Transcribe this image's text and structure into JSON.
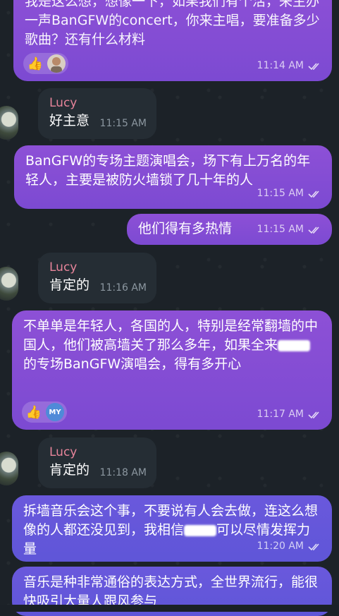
{
  "messages": [
    {
      "id": "m1",
      "direction": "out",
      "text_partial_top": "我是这么想，想像一下，如果我们有个活，",
      "text": "来主办一声BanGFW的concert，你来主唱，要准备多少歌曲？还有什么材料",
      "time": "11:14 AM",
      "reactions": [
        "thumbs-up",
        "user-avatar"
      ]
    },
    {
      "id": "m2",
      "direction": "in",
      "sender": "Lucy",
      "text": "好主意",
      "time": "11:15 AM"
    },
    {
      "id": "m3",
      "direction": "out",
      "text": "BanGFW的专场主题演唱会，场下有上万名的年轻人，主要是被防火墙锁了几十年的人",
      "time": "11:15 AM"
    },
    {
      "id": "m4",
      "direction": "out",
      "text": "他们得有多热情",
      "time": "11:15 AM"
    },
    {
      "id": "m5",
      "direction": "in",
      "sender": "Lucy",
      "text": "肯定的",
      "time": "11:16 AM"
    },
    {
      "id": "m6",
      "direction": "out",
      "text_a": "不单单是年轻人，各国的人，特别是经常翻墙的中国人，他们被高墙关了那么多年，如果全来",
      "text_b": "的专场BanGFW演唱会，得有多开心",
      "time": "11:17 AM",
      "reaction_initials": "MY"
    },
    {
      "id": "m7",
      "direction": "in",
      "sender": "Lucy",
      "text": "肯定的",
      "time": "11:18 AM"
    },
    {
      "id": "m8",
      "direction": "out",
      "text_a": "拆墙音乐会这个事，不要说有人会去做，连这么想像的人都还没见到，我相信",
      "text_b": "可以尽情发挥力量",
      "time": "11:20 AM"
    },
    {
      "id": "m9",
      "direction": "out",
      "text": "音乐是种非常通俗的表达方式，全世界流行，能很快吸引大量人跟风参与"
    }
  ]
}
